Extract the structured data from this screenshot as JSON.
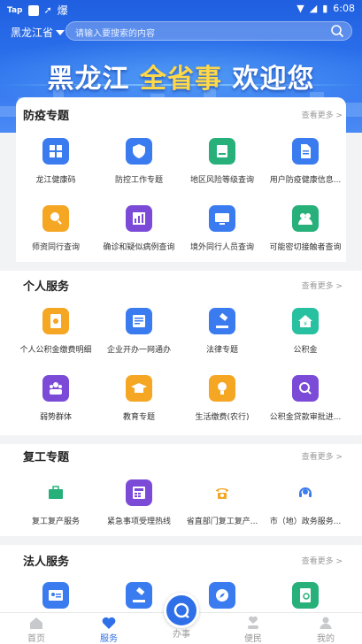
{
  "status": {
    "app": "Tap",
    "icon_extra": "爆",
    "time": "6:08"
  },
  "header": {
    "province": "黑龙江省",
    "search_placeholder": "请输入要搜索的内容"
  },
  "banner": {
    "part1": "黑龙江",
    "part2": "全省事",
    "part3": "欢迎您"
  },
  "sections": [
    {
      "title": "防疫专题",
      "more": "查看更多 >",
      "items": [
        {
          "label": "龙江健康码",
          "icon": "grid-icon",
          "color": "#3a7bf0"
        },
        {
          "label": "防控工作专题",
          "icon": "shield-icon",
          "color": "#3a7bf0"
        },
        {
          "label": "地区风险等级查询",
          "icon": "report-icon",
          "color": "#27b07a"
        },
        {
          "label": "用户防疫健康信息...",
          "icon": "document-icon",
          "color": "#3a7bf0"
        },
        {
          "label": "师资同行查询",
          "icon": "person-search-icon",
          "color": "#f5a623"
        },
        {
          "label": "确诊和疑似病例查询",
          "icon": "chart-icon",
          "color": "#7b4bd8"
        },
        {
          "label": "境外同行人员查询",
          "icon": "monitor-icon",
          "color": "#3a7bf0"
        },
        {
          "label": "可能密切接触者查询",
          "icon": "people-icon",
          "color": "#27b07a"
        }
      ]
    },
    {
      "title": "个人服务",
      "more": "查看更多 >",
      "items": [
        {
          "label": "个人公积金缴费明细",
          "icon": "coin-doc-icon",
          "color": "#f5a623"
        },
        {
          "label": "企业开办一网通办",
          "icon": "form-icon",
          "color": "#3a7bf0"
        },
        {
          "label": "法律专题",
          "icon": "gavel-icon",
          "color": "#3a7bf0"
        },
        {
          "label": "公积金",
          "icon": "house-icon",
          "color": "#27c0a0"
        },
        {
          "label": "弱势群体",
          "icon": "group-icon",
          "color": "#7b4bd8"
        },
        {
          "label": "教育专题",
          "icon": "graduation-icon",
          "color": "#f5a623"
        },
        {
          "label": "生活缴费(农行)",
          "icon": "bulb-icon",
          "color": "#f5a623"
        },
        {
          "label": "公积金贷款审批进...",
          "icon": "search-money-icon",
          "color": "#7b4bd8"
        }
      ]
    },
    {
      "title": "复工专题",
      "more": "查看更多 >",
      "items": [
        {
          "label": "复工复产服务",
          "icon": "briefcase-icon",
          "color": "#27b07a"
        },
        {
          "label": "紧急事项受理热线",
          "icon": "phone-desk-icon",
          "color": "#7b4bd8"
        },
        {
          "label": "省直部门复工复产...",
          "icon": "phone-icon",
          "color": "#f5a623"
        },
        {
          "label": "市（地）政务服务...",
          "icon": "headset-icon",
          "color": "#3a7bf0"
        }
      ]
    },
    {
      "title": "法人服务",
      "more": "查看更多 >",
      "items": [
        {
          "label": "",
          "icon": "id-card-icon",
          "color": "#3a7bf0"
        },
        {
          "label": "",
          "icon": "gavel-icon",
          "color": "#3a7bf0"
        },
        {
          "label": "",
          "icon": "compass-icon",
          "color": "#3a7bf0"
        },
        {
          "label": "",
          "icon": "doc-search-icon",
          "color": "#27b07a"
        }
      ]
    }
  ],
  "tabbar": {
    "home": "首页",
    "service": "服务",
    "center": "办事",
    "people": "便民",
    "mine": "我的",
    "active_color": "#2f6fe8"
  }
}
